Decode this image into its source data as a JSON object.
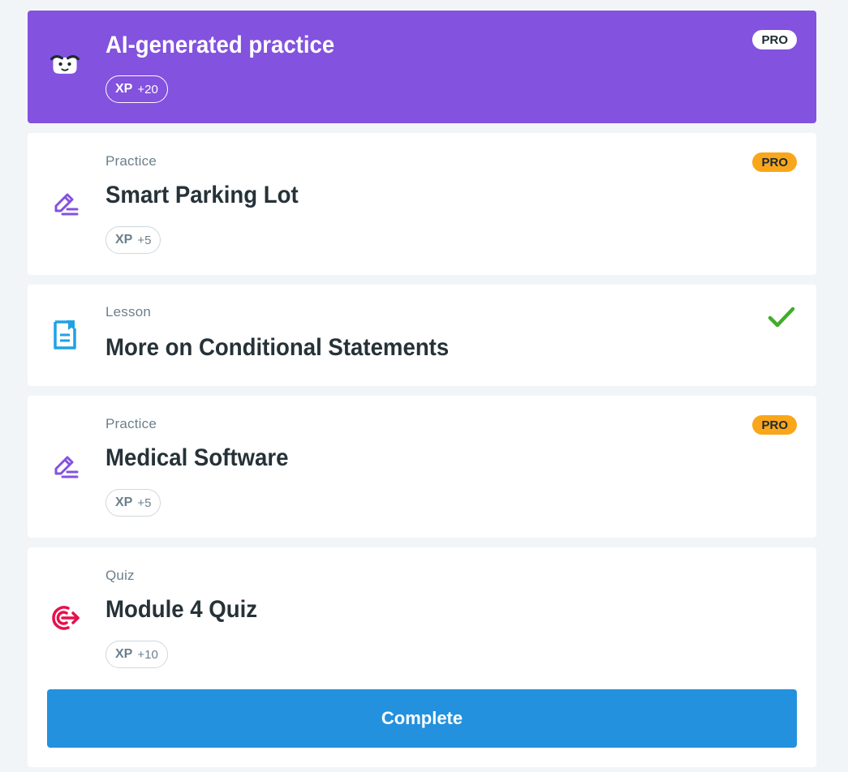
{
  "items": [
    {
      "kind": "ai",
      "icon": "ai-mascot-icon",
      "title": "AI-generated practice",
      "xp_label": "XP",
      "xp_value": "+20",
      "badge": "PRO"
    },
    {
      "kind": "practice",
      "icon": "pencil-icon",
      "type": "Practice",
      "title": "Smart Parking Lot",
      "xp_label": "XP",
      "xp_value": "+5",
      "badge": "PRO"
    },
    {
      "kind": "lesson",
      "icon": "lesson-document-icon",
      "type": "Lesson",
      "title": "More on Conditional Statements",
      "status": "completed-checkmark-icon"
    },
    {
      "kind": "practice",
      "icon": "pencil-icon",
      "type": "Practice",
      "title": "Medical Software",
      "xp_label": "XP",
      "xp_value": "+5",
      "badge": "PRO"
    },
    {
      "kind": "quiz",
      "icon": "target-icon",
      "type": "Quiz",
      "title": "Module 4 Quiz",
      "xp_label": "XP",
      "xp_value": "+10",
      "button_label": "Complete"
    }
  ],
  "colors": {
    "ai_bg": "#8352de",
    "pro_orange": "#f9a61b",
    "button_blue": "#2391dd",
    "check_green": "#3fae29",
    "quiz_red": "#e8104a",
    "lesson_blue": "#1ea2e6",
    "practice_purple": "#8352de"
  }
}
